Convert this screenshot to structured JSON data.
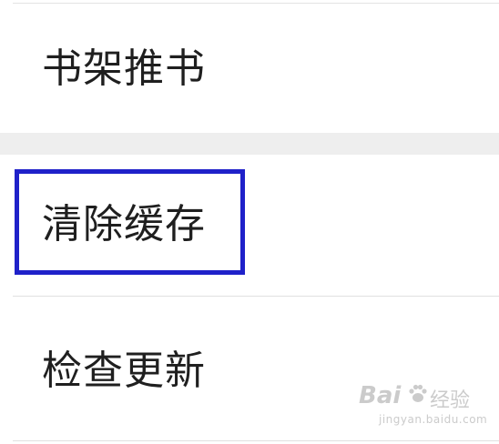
{
  "menu": {
    "items": [
      {
        "label": "书架推书"
      },
      {
        "label": "清除缓存"
      },
      {
        "label": "检查更新"
      }
    ]
  },
  "highlight": {
    "target": "清除缓存",
    "color": "#1f21c9"
  },
  "watermark": {
    "logo": "Bai",
    "text": "经验",
    "sub": "jingyan.baidu.com",
    "icon": "paw-icon"
  },
  "colors": {
    "background": "#ffffff",
    "section_gap": "#eeeeee",
    "text": "#1f1f1f",
    "divider": "#e0e0e0"
  }
}
